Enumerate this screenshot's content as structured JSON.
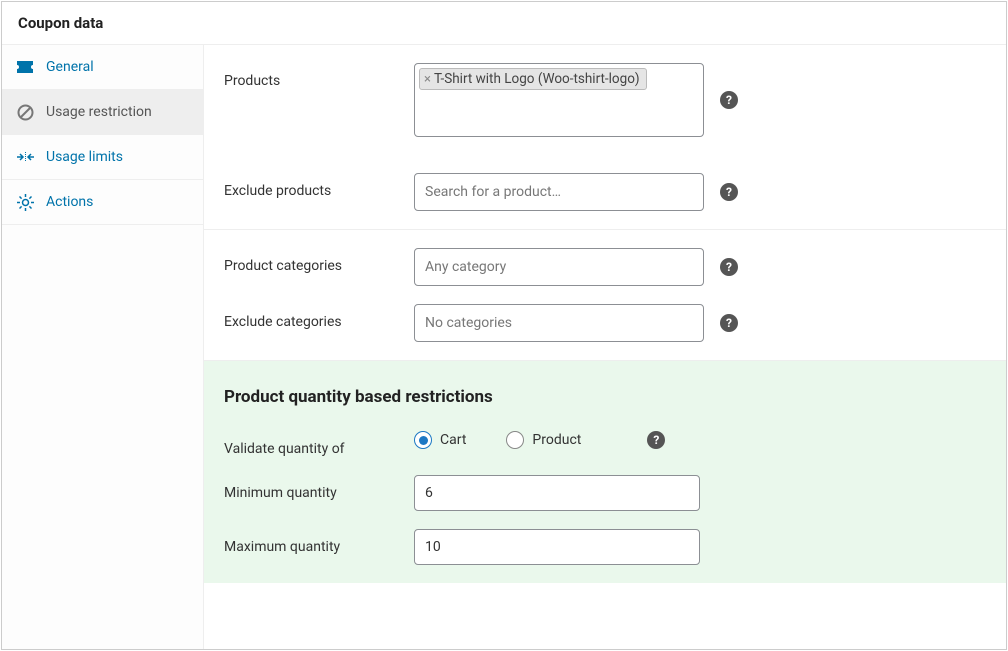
{
  "header": {
    "title": "Coupon data"
  },
  "sidebar": {
    "items": [
      {
        "label": "General"
      },
      {
        "label": "Usage restriction"
      },
      {
        "label": "Usage limits"
      },
      {
        "label": "Actions"
      }
    ]
  },
  "form": {
    "products": {
      "label": "Products",
      "tags": [
        "T-Shirt with Logo (Woo-tshirt-logo)"
      ]
    },
    "exclude_products": {
      "label": "Exclude products",
      "placeholder": "Search for a product…"
    },
    "product_categories": {
      "label": "Product categories",
      "placeholder": "Any category"
    },
    "exclude_categories": {
      "label": "Exclude categories",
      "placeholder": "No categories"
    }
  },
  "quantity_section": {
    "heading": "Product quantity based restrictions",
    "validate_label": "Validate quantity of",
    "options": {
      "cart": "Cart",
      "product": "Product"
    },
    "selected": "cart",
    "min_label": "Minimum quantity",
    "min_value": "6",
    "max_label": "Maximum quantity",
    "max_value": "10"
  }
}
